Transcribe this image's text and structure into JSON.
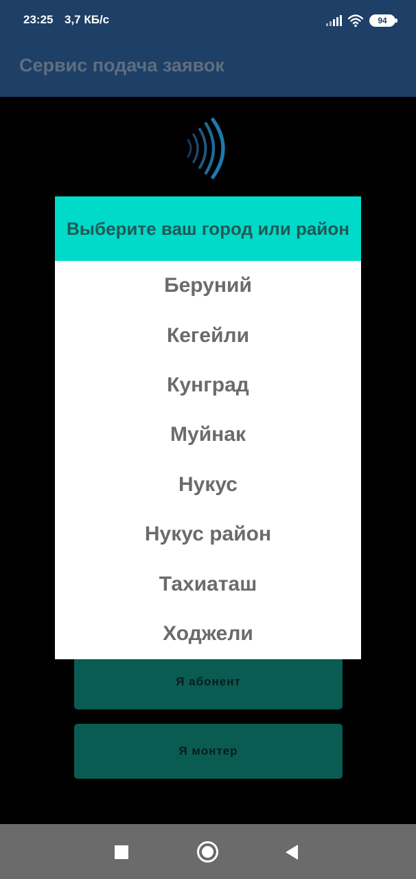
{
  "status_bar": {
    "time": "23:25",
    "speed": "3,7 КБ/с",
    "battery": "94"
  },
  "app_bar": {
    "title": "Сервис подача заявок"
  },
  "background_buttons": {
    "abonent": "Я абонент",
    "monter": "Я монтер"
  },
  "dialog": {
    "title": "Выберите ваш город или район",
    "items": [
      {
        "label": "Беруний"
      },
      {
        "label": "Кегейли"
      },
      {
        "label": "Кунград"
      },
      {
        "label": "Муйнак"
      },
      {
        "label": "Нукус"
      },
      {
        "label": "Нукус район"
      },
      {
        "label": "Тахиаташ"
      },
      {
        "label": "Ходжели"
      }
    ]
  },
  "colors": {
    "app_bar": "#1e3f66",
    "dialog_header": "#00dac9",
    "button": "#0a5b52",
    "nav_bar": "#6b6b6b"
  },
  "icons": {
    "nfc": "nfc-waves-icon",
    "nav_recent": "square-icon",
    "nav_home": "circle-icon",
    "nav_back": "triangle-back-icon"
  }
}
